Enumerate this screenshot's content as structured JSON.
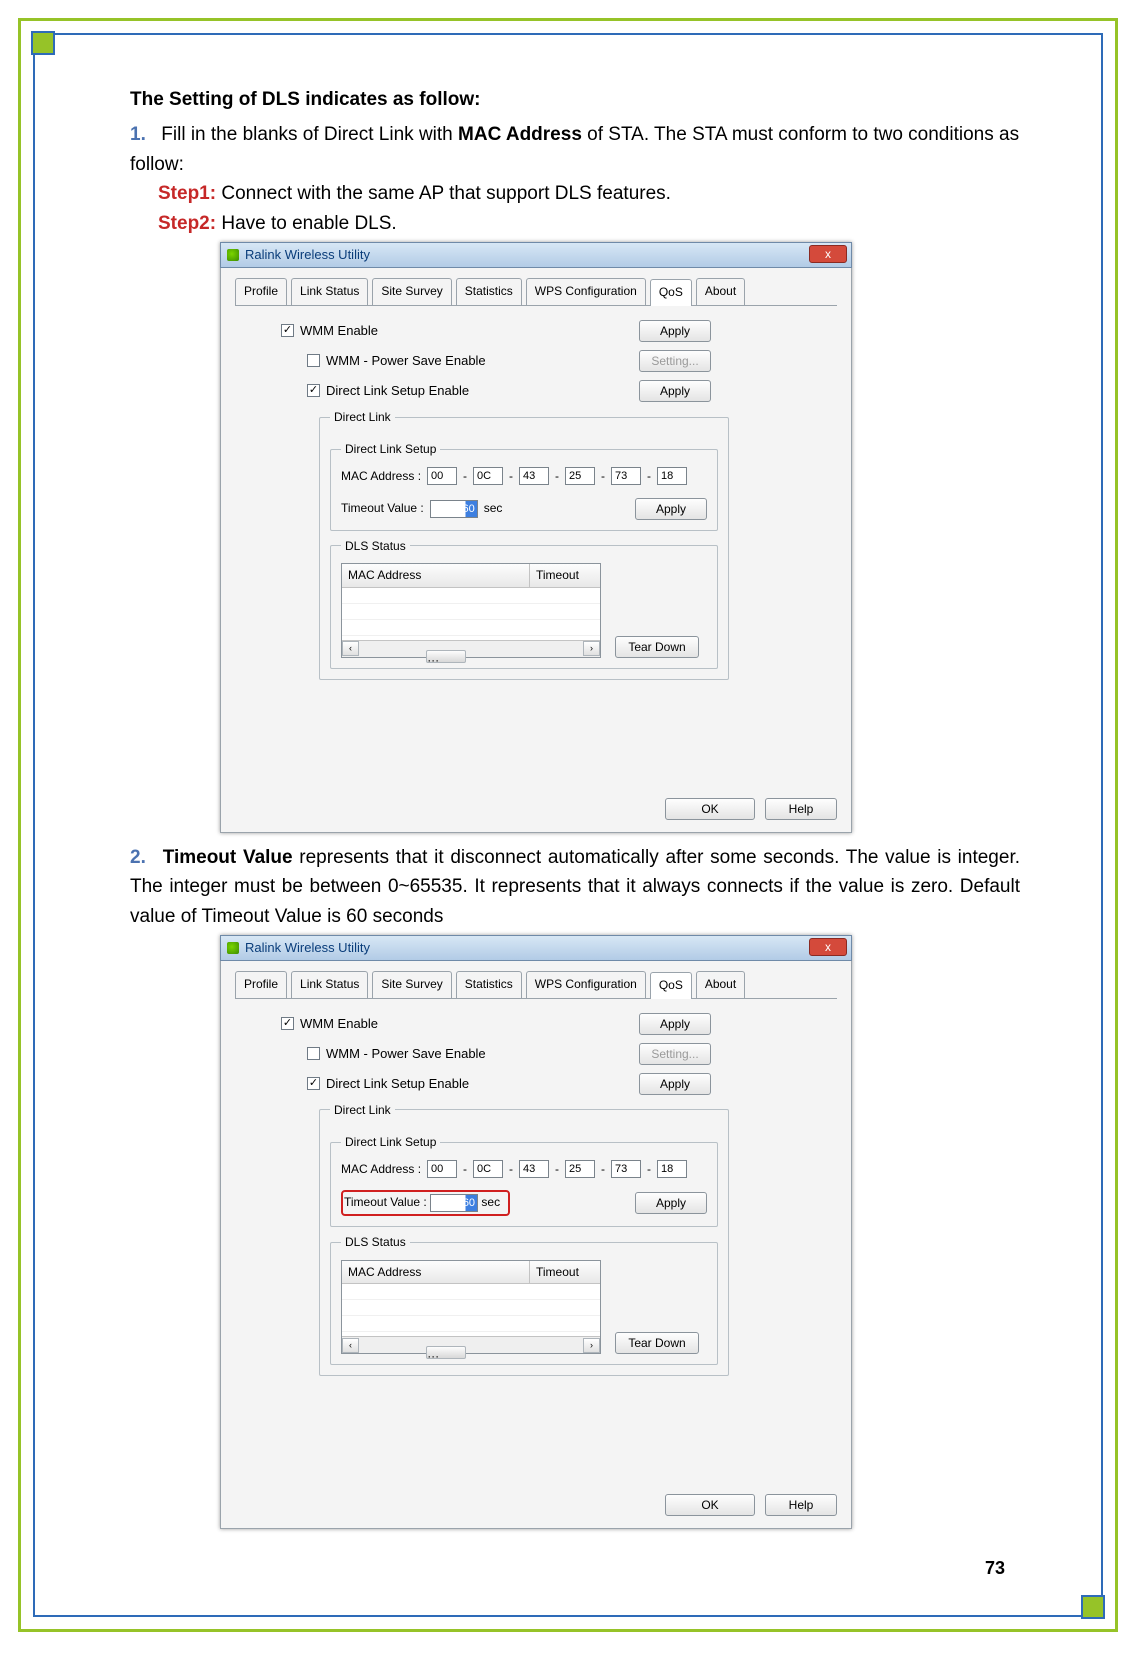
{
  "page_number": "73",
  "heading": "The Setting of DLS indicates as follow:",
  "item1_num": "1.",
  "item1_text_a": "Fill in the blanks of Direct Link with ",
  "item1_mac": "MAC Address",
  "item1_text_b": " of STA. The STA must conform to two conditions as follow:",
  "step1_label": "Step1:",
  "step1_text": " Connect with the same AP that support DLS features.",
  "step2_label": "Step2:",
  "step2_text": " Have to enable DLS.",
  "item2_num": "2.",
  "item2_bold": "Timeout Value",
  "item2_text": " represents that it disconnect automatically after some seconds. The value is integer. The integer must be between 0~65535. It represents that it always connects if the value is zero. Default value of Timeout Value is 60 seconds",
  "dialog": {
    "title": "Ralink Wireless Utility",
    "close": "x",
    "tabs": [
      "Profile",
      "Link Status",
      "Site Survey",
      "Statistics",
      "WPS Configuration",
      "QoS",
      "About"
    ],
    "active_tab": "QoS",
    "wmm_enable": "WMM Enable",
    "wmm_ps": "WMM - Power Save Enable",
    "dls_enable": "Direct Link Setup Enable",
    "btn_apply": "Apply",
    "btn_setting": "Setting...",
    "btn_ok": "OK",
    "btn_help": "Help",
    "btn_teardown": "Tear Down",
    "fs_direct_link": "Direct Link",
    "fs_dls_setup": "Direct Link Setup",
    "fs_dls_status": "DLS Status",
    "lbl_mac": "MAC Address :",
    "lbl_timeout": "Timeout Value :",
    "lbl_sec": "sec",
    "mac": [
      "00",
      "0C",
      "43",
      "25",
      "73",
      "18"
    ],
    "mac_sep": "-",
    "timeout_value": "60",
    "th_mac": "MAC Address",
    "th_timeout": "Timeout",
    "scroll_left": "‹",
    "scroll_right": "›",
    "scroll_thumb": "···"
  }
}
